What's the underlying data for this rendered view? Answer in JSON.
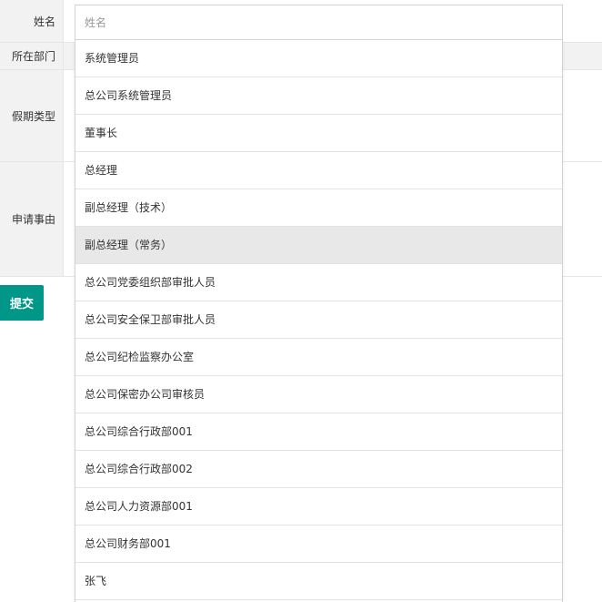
{
  "form": {
    "name_label": "姓名",
    "name_placeholder": "姓名",
    "name_value": "",
    "dept_label": "所在部门",
    "leave_type_label": "假期类型",
    "reason_label": "申请事由",
    "submit_label": "提交"
  },
  "dropdown": {
    "hovered_index": 5,
    "items": [
      "系统管理员",
      "总公司系统管理员",
      "董事长",
      "总经理",
      "副总经理（技术）",
      "副总经理（常务）",
      "总公司党委组织部审批人员",
      "总公司安全保卫部审批人员",
      "总公司纪检监察办公室",
      "总公司保密办公司审核员",
      "总公司综合行政部001",
      "总公司综合行政部002",
      "总公司人力资源部001",
      "总公司财务部001",
      "张飞"
    ]
  },
  "colors": {
    "primary": "#009688",
    "label_bg": "#f2f2f2",
    "border": "#e6e6e6",
    "hover": "#e8e8e8"
  }
}
